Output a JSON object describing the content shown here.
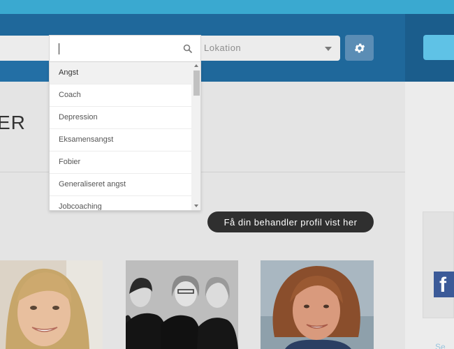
{
  "search": {
    "keyword_value": "",
    "keyword_placeholder": "",
    "location_placeholder": "Lokation"
  },
  "dropdown": {
    "options": [
      "Angst",
      "Coach",
      "Depression",
      "Eksamensangst",
      "Fobier",
      "Generaliseret angst",
      "Jobcoaching"
    ],
    "highlighted_index": 0
  },
  "main": {
    "heading_fragment": "ER",
    "profile_button_label": "Få din behandler profil vist her"
  },
  "sidebar": {
    "social_icon_label": "f",
    "bottom_label": "Se"
  },
  "colors": {
    "top_strip": "#3aa9d0",
    "nav_bar": "#1f689b",
    "gear_button": "#5b8db5",
    "cta_button": "#2f2f2f",
    "facebook": "#3b5a98"
  },
  "icons": {
    "search": "search-icon",
    "gear": "gear-icon",
    "chevron": "chevron-down-icon"
  }
}
